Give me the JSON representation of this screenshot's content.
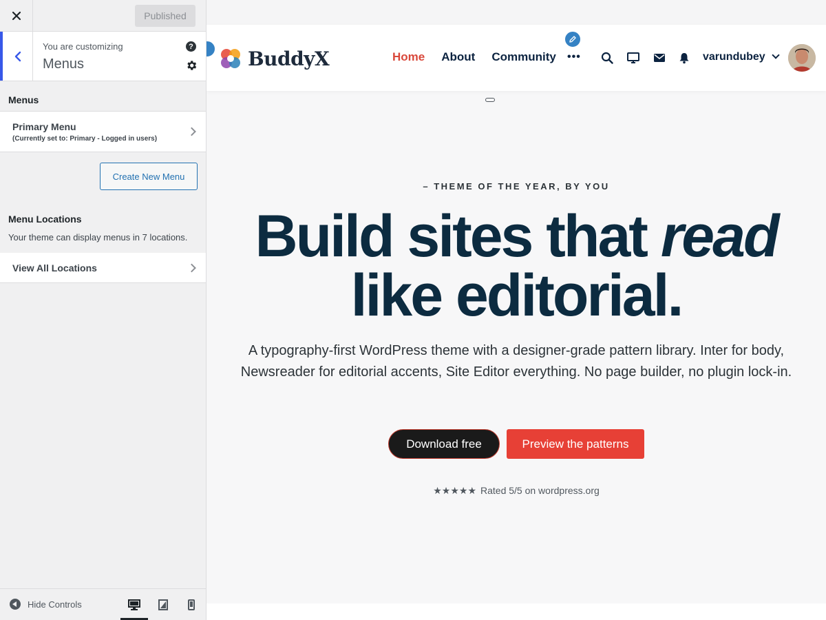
{
  "sidebar": {
    "publish_label": "Published",
    "customizing_label": "You are customizing",
    "section_name": "Menus",
    "help_glyph": "?",
    "menus_heading": "Menus",
    "menu_item": {
      "title": "Primary Menu",
      "subtitle": "(Currently set to: Primary - Logged in users)"
    },
    "create_menu_label": "Create New Menu",
    "locations_heading": "Menu Locations",
    "locations_desc": "Your theme can display menus in 7 locations.",
    "view_locations_label": "View All Locations",
    "hide_controls_label": "Hide Controls",
    "accent_color": "#3858e9"
  },
  "site": {
    "logo_text": "BuddyX",
    "nav": [
      {
        "label": "Home",
        "active": true
      },
      {
        "label": "About",
        "active": false
      },
      {
        "label": "Community",
        "active": false
      }
    ],
    "nav_more": "•••",
    "username": "varundubey",
    "nav_active_color": "#d9483b",
    "header_icons": [
      "search-icon",
      "monitor-icon",
      "mail-icon",
      "bell-icon"
    ]
  },
  "hero": {
    "kicker": "– THEME OF THE YEAR, BY YOU",
    "title_part1": "Build sites that ",
    "title_italic": "read",
    "title_part2": "like editorial.",
    "description": "A typography-first WordPress theme with a designer-grade pattern library. Inter for body, Newsreader for editorial accents, Site Editor everything. No page builder, no plugin lock-in.",
    "primary_cta": "Download free",
    "secondary_cta": "Preview the patterns",
    "stars": "★★★★★",
    "rating_text": "Rated 5/5 on wordpress.org",
    "cta_color": "#e74036"
  }
}
